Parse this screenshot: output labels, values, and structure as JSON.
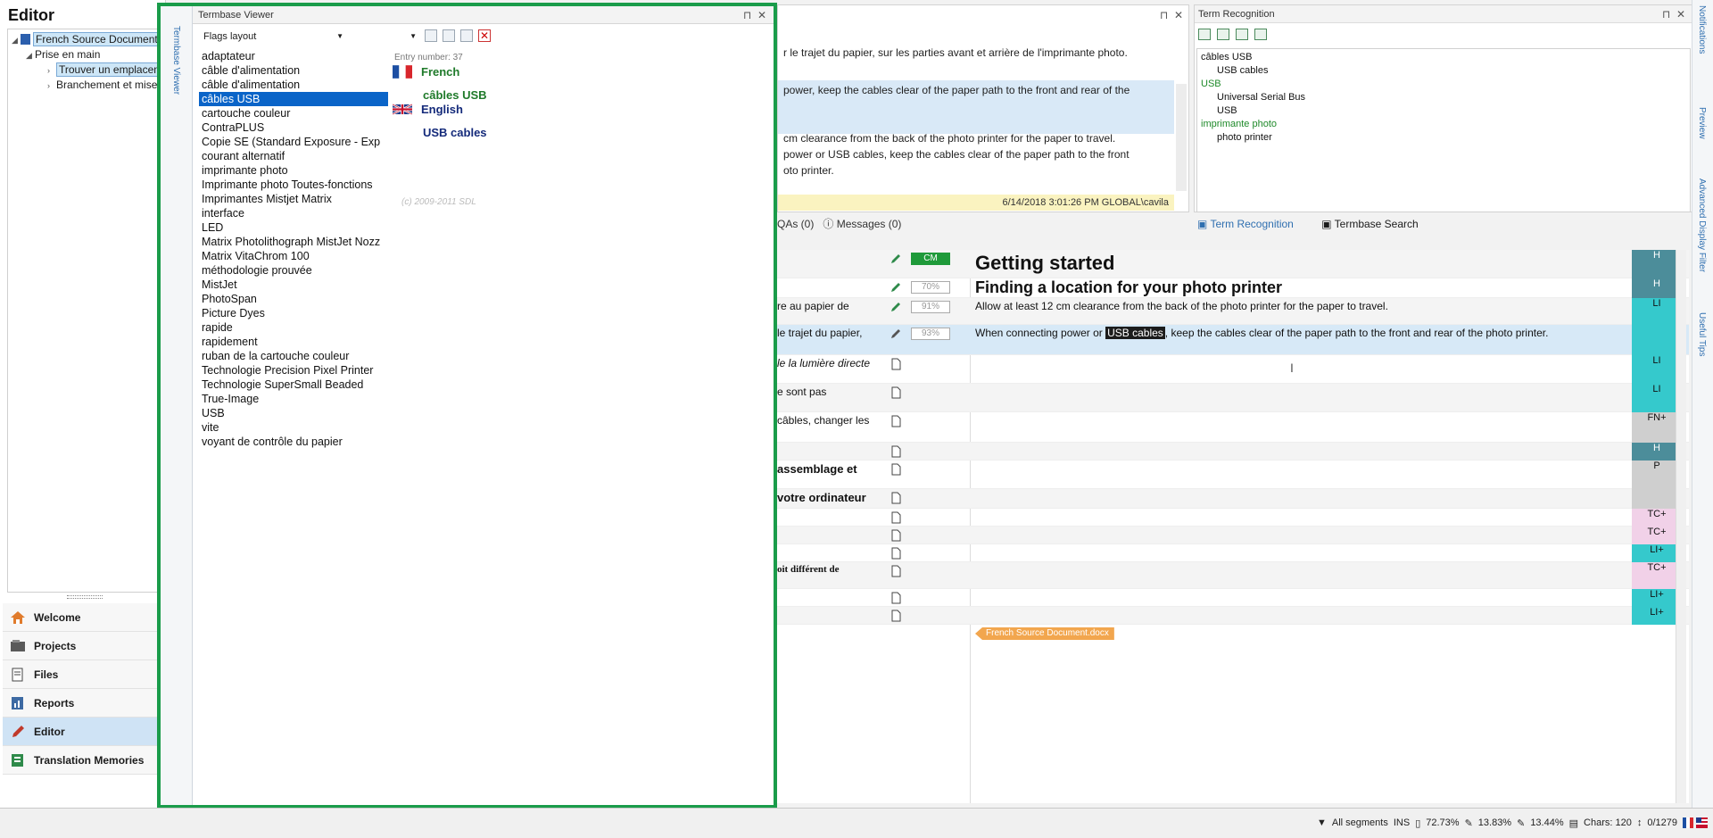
{
  "app": {
    "editor_title": "Editor"
  },
  "tree": {
    "root": "French Source Document",
    "child1": "Prise en main",
    "child2": "Trouver un emplacement",
    "child3": "Branchement et mise"
  },
  "nav": {
    "items": [
      {
        "label": "Welcome"
      },
      {
        "label": "Projects"
      },
      {
        "label": "Files"
      },
      {
        "label": "Reports"
      },
      {
        "label": "Editor"
      },
      {
        "label": "Translation Memories"
      }
    ]
  },
  "termbase": {
    "title": "Termbase Viewer",
    "side_label": "Termbase Viewer",
    "layout": "Flags layout",
    "entry_number": "Entry number:  37",
    "source_lang": "French",
    "source_term": "câbles USB",
    "target_lang": "English",
    "target_term": "USB cables",
    "copyright": "(c) 2009-2011 SDL",
    "terms": [
      "adaptateur",
      "câble d'alimentation",
      "câble d'alimentation",
      "câbles USB",
      "cartouche couleur",
      "ContraPLUS",
      "Copie SE (Standard Exposure - Exp",
      "courant alternatif",
      "imprimante photo",
      "Imprimante photo Toutes-fonctions",
      "Imprimantes Mistjet Matrix",
      "interface",
      "LED",
      "Matrix Photolithograph MistJet Nozz",
      "Matrix VitaChrom 100",
      "méthodologie prouvée",
      "MistJet",
      "PhotoSpan",
      "Picture Dyes",
      "rapide",
      "rapidement",
      "ruban de la cartouche couleur",
      "Technologie Precision Pixel Printer",
      "Technologie SuperSmall Beaded",
      "True-Image",
      "USB",
      "vite",
      "voyant de contrôle du papier"
    ]
  },
  "preview": {
    "line1": "r le trajet du papier, sur les parties avant et arrière de l'imprimante photo.",
    "line2": "power, keep the cables clear of the paper path to the front and rear of the",
    "line3": "cm clearance from the back of the photo printer for the paper to travel.",
    "line4": "power or USB cables, keep the cables clear of the paper path to the front",
    "line5": "oto printer.",
    "status": "6/14/2018 3:01:26 PM  GLOBAL\\cavila",
    "tab_qas": "QAs (0)",
    "tab_messages": "Messages (0)"
  },
  "term_recognition": {
    "title": "Term Recognition",
    "rows": [
      {
        "text": "câbles USB",
        "kind": "src"
      },
      {
        "text": "USB cables",
        "kind": "tgt"
      },
      {
        "text": "USB",
        "kind": "srcgreen"
      },
      {
        "text": "Universal Serial Bus",
        "kind": "tgt"
      },
      {
        "text": "USB",
        "kind": "tgt"
      },
      {
        "text": "imprimante photo",
        "kind": "srcgreen"
      },
      {
        "text": "photo printer",
        "kind": "tgt"
      }
    ],
    "tab1": "Term Recognition",
    "tab2": "Termbase Search"
  },
  "right_strip": {
    "notifications": "Notifications",
    "preview": "Preview",
    "adf": "Advanced Display Filter",
    "tips": "Useful Tips"
  },
  "grid": {
    "rows": [
      {
        "src": "",
        "match": "CM",
        "tgt": "Getting started",
        "tag": "H",
        "style": "h1"
      },
      {
        "src": "",
        "match": "70%",
        "tgt": "Finding a location for your photo printer",
        "tag": "H",
        "style": "h2"
      },
      {
        "src": "re au papier de",
        "match": "91%",
        "tgt": "Allow at least 12 cm clearance from the back of the photo printer for the paper to travel.",
        "tag": "LI",
        "style": "p"
      },
      {
        "src": "le trajet du papier,",
        "match": "93%",
        "tgt_pre": "When connecting power or ",
        "tgt_hl": "USB cables",
        "tgt_post": ", keep the cables clear of the paper path to the front and rear of the photo printer.",
        "tag": "",
        "style": "active"
      },
      {
        "src": "le la lumière directe",
        "match": "",
        "tgt": "",
        "tag": "LI",
        "style": "p"
      },
      {
        "src": "e sont pas",
        "match": "",
        "tgt": "",
        "tag": "LI",
        "style": "p"
      },
      {
        "src": "câbles, changer les",
        "match": "",
        "tgt": "",
        "tag": "FN+",
        "style": "p"
      },
      {
        "src": "",
        "match": "",
        "tgt": "",
        "tag": "H",
        "style": "p"
      },
      {
        "src": "assemblage et",
        "match": "",
        "tgt": "",
        "tag": "P",
        "style": "p"
      },
      {
        "src": "votre ordinateur",
        "match": "",
        "tgt": "",
        "tag": "",
        "style": "p"
      },
      {
        "src": "",
        "match": "",
        "tgt": "",
        "tag": "TC+",
        "style": "p"
      },
      {
        "src": "",
        "match": "",
        "tgt": "",
        "tag": "TC+",
        "style": "p"
      },
      {
        "src": "",
        "match": "",
        "tgt": "",
        "tag": "LI+",
        "style": "p"
      },
      {
        "src": "oit différent de",
        "match": "",
        "tgt": "",
        "tag": "TC+",
        "style": "p"
      },
      {
        "src": "",
        "match": "",
        "tgt": "",
        "tag": "LI+",
        "style": "p"
      },
      {
        "src": "",
        "match": "",
        "tgt": "",
        "tag": "LI+",
        "style": "p"
      }
    ],
    "end_tag": "French Source Document.docx"
  },
  "status_bar": {
    "filter": "All segments",
    "mode": "INS",
    "pct1": "72.73%",
    "pct2": "13.83%",
    "pct3": "13.44%",
    "chars": "Chars: 120",
    "pos": "0/1279"
  },
  "colors": {
    "accent_green": "#1a9c4a",
    "selection_blue": "#0a64c8",
    "tag_teal": "#35c9cc",
    "tag_slate": "#4c8d9a",
    "tag_pink": "#f1d1e8"
  }
}
